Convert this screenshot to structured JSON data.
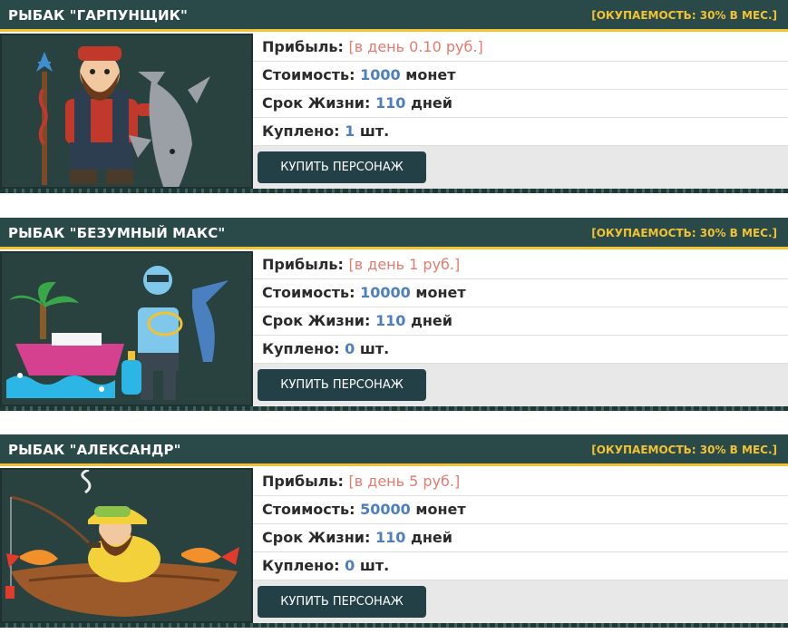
{
  "labels": {
    "profit": "Прибыль:",
    "cost": "Стоимость:",
    "lifetime": "Срок Жизни:",
    "bought": "Куплено:"
  },
  "cards": [
    {
      "title": "РЫБАК \"ГАРПУНЩИК\"",
      "roi": "[ОКУПАЕМОСТЬ: 30% В МЕС.]",
      "profit_value": "[в день 0.10 руб.]",
      "cost_value": "1000",
      "cost_unit": "монет",
      "life_value": "110",
      "life_unit": "дней",
      "bought_value": "1",
      "bought_unit": "шт.",
      "button": "КУПИТЬ ПЕРСОНАЖ"
    },
    {
      "title": "РЫБАК \"БЕЗУМНЫЙ МАКС\"",
      "roi": "[ОКУПАЕМОСТЬ: 30% В МЕС.]",
      "profit_value": "[в день 1 руб.]",
      "cost_value": "10000",
      "cost_unit": "монет",
      "life_value": "110",
      "life_unit": "дней",
      "bought_value": "0",
      "bought_unit": "шт.",
      "button": "КУПИТЬ ПЕРСОНАЖ"
    },
    {
      "title": "РЫБАК \"АЛЕКСАНДР\"",
      "roi": "[ОКУПАЕМОСТЬ: 30% В МЕС.]",
      "profit_value": "[в день 5 руб.]",
      "cost_value": "50000",
      "cost_unit": "монет",
      "life_value": "110",
      "life_unit": "дней",
      "bought_value": "0",
      "bought_unit": "шт.",
      "button": "КУПИТЬ ПЕРСОНАЖ"
    }
  ],
  "colors": {
    "header_bg": "#2a4a4a",
    "accent_yellow": "#f2c233",
    "profit_red": "#e57a6e",
    "value_blue": "#4d7fc0",
    "button_bg": "#234047"
  }
}
